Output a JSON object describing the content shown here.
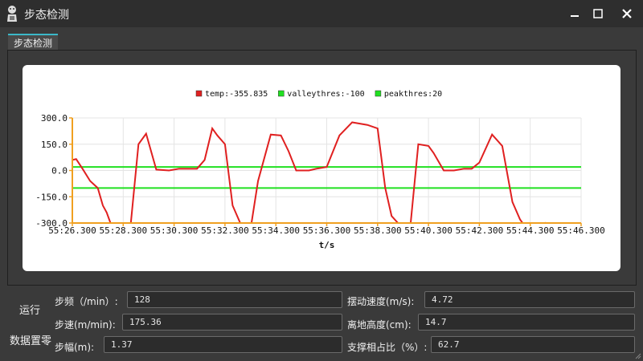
{
  "window": {
    "title": "步态检测"
  },
  "tabs": [
    {
      "label": "步态检测"
    }
  ],
  "side": {
    "run_label": "运行",
    "reset_label": "数据置零"
  },
  "fields": {
    "step_freq": {
      "label": "步频（/min）:",
      "value": "128"
    },
    "step_speed": {
      "label": "步速(m/min):",
      "value": "175.36"
    },
    "stride": {
      "label": "步幅(m):",
      "value": "1.37"
    },
    "swing_speed": {
      "label": "摆动速度(m/s):",
      "value": "4.72"
    },
    "ground_height": {
      "label": "离地高度(cm):",
      "value": "14.7"
    },
    "support_ratio": {
      "label": "支撑相占比（%）:",
      "value": "62.7"
    }
  },
  "chart_data": {
    "type": "line",
    "xlabel": "t/s",
    "ylabel": "",
    "ylim": [
      -300,
      300
    ],
    "yticks": [
      "300.0",
      "150.0",
      "0.0",
      "-150.0",
      "-300.0"
    ],
    "xticks": [
      "55:26.300",
      "55:28.300",
      "55:30.300",
      "55:32.300",
      "55:34.300",
      "55:36.300",
      "55:38.300",
      "55:40.300",
      "55:42.300",
      "55:44.300",
      "55:46.300"
    ],
    "legend_position": "top",
    "legend": [
      {
        "label": "temp:-355.835",
        "color": "#e02020"
      },
      {
        "label": "valleythres:-100",
        "color": "#20e020"
      },
      {
        "label": "peakthres:20",
        "color": "#20e020"
      }
    ],
    "series": [
      {
        "name": "temp",
        "color": "#e02020",
        "x": [
          0,
          0.15,
          0.4,
          0.7,
          1.0,
          1.2,
          1.35,
          1.5,
          1.7,
          2.3,
          2.6,
          2.9,
          3.3,
          3.8,
          4.2,
          4.6,
          4.9,
          5.2,
          5.5,
          5.7,
          6.0,
          6.3,
          6.6,
          6.8,
          7.0,
          7.3,
          7.8,
          8.2,
          8.5,
          8.8,
          9.0,
          9.3,
          9.6,
          10.0,
          10.5,
          11.0,
          11.6,
          12.0,
          12.3,
          12.55,
          12.8,
          13.0,
          13.3,
          13.6,
          14.0,
          14.2,
          14.6,
          15.0,
          15.4,
          15.7,
          16.0,
          16.5,
          16.9,
          17.3,
          17.6,
          17.9,
          18.3,
          18.6,
          18.9,
          19.1,
          19.4,
          19.7,
          20.0,
          20.2
        ],
        "values": [
          60,
          65,
          10,
          -60,
          -100,
          -200,
          -240,
          -300,
          -340,
          -300,
          150,
          210,
          5,
          0,
          10,
          10,
          10,
          60,
          240,
          200,
          150,
          -200,
          -300,
          -340,
          -340,
          -60,
          205,
          200,
          110,
          0,
          0,
          0,
          10,
          20,
          200,
          275,
          260,
          240,
          -100,
          -260,
          -300,
          -340,
          -300,
          150,
          140,
          100,
          0,
          0,
          10,
          10,
          45,
          205,
          140,
          -180,
          -280,
          -340,
          -340,
          -300,
          -340,
          -340,
          -340,
          -340,
          -340,
          -340
        ]
      },
      {
        "name": "valleythres",
        "color": "#20e020",
        "constant": -100
      },
      {
        "name": "peakthres",
        "color": "#20e020",
        "constant": 20
      }
    ]
  }
}
